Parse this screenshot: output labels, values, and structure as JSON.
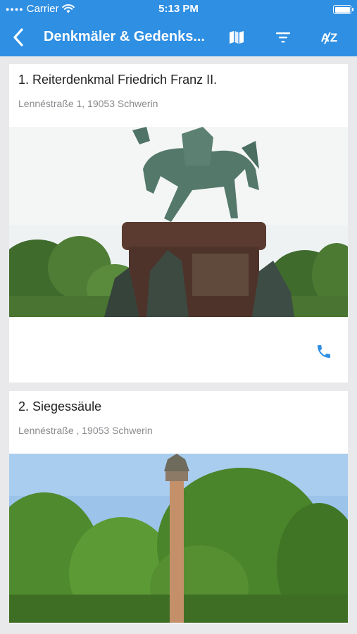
{
  "status_bar": {
    "carrier": "Carrier",
    "time": "5:13 PM"
  },
  "nav": {
    "title": "Denkmäler & Gedenks...",
    "back_icon": "chevron-left-icon",
    "map_icon": "map-icon",
    "filter_icon": "filter-icon",
    "sort_icon": "sort-az-icon",
    "sort_label": "AZ"
  },
  "items": [
    {
      "title": "1. Reiterdenkmal Friedrich Franz II.",
      "address": "Lennéstraße 1, 19053 Schwerin",
      "image": "equestrian-statue-photo",
      "phone_icon": "phone-icon"
    },
    {
      "title": "2. Siegessäule",
      "address": "Lennéstraße , 19053 Schwerin",
      "image": "victory-column-photo"
    }
  ],
  "colors": {
    "accent": "#2f8fe3",
    "background": "#e9e9ec",
    "secondary_text": "#8a8a8f"
  }
}
